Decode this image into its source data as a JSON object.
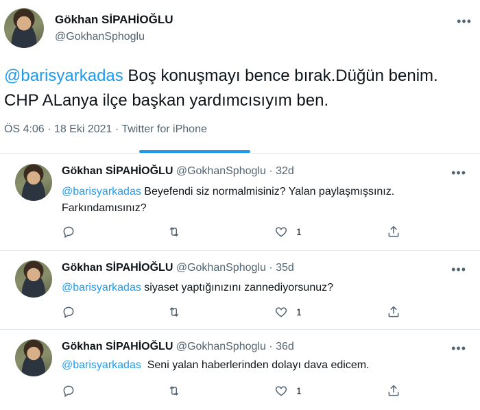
{
  "main_tweet": {
    "name": "Gökhan SİPAHİOĞLU",
    "handle": "@GokhanSphoglu",
    "mention": "@barisyarkadas",
    "text": " Boş konuşmayı bence bırak.Düğün benim. CHP ALanya ilçe başkan yardımcısıyım ben.",
    "meta": "ÖS 4:06 · 18 Eki 2021 · Twitter for iPhone"
  },
  "replies": [
    {
      "name": "Gökhan SİPAHİOĞLU",
      "handle": "@GokhanSphoglu",
      "separator": "·",
      "time": "32d",
      "mention": "@barisyarkadas",
      "text": " Beyefendi siz normalmisiniz? Yalan paylaşmışsınız. Farkındamısınız?",
      "like_count": "1"
    },
    {
      "name": "Gökhan SİPAHİOĞLU",
      "handle": "@GokhanSphoglu",
      "separator": "·",
      "time": "35d",
      "mention": "@barisyarkadas",
      "text": " siyaset yaptığınızını zannediyorsunuz?",
      "like_count": "1"
    },
    {
      "name": "Gökhan SİPAHİOĞLU",
      "handle": "@GokhanSphoglu",
      "separator": "·",
      "time": "36d",
      "mention": "@barisyarkadas",
      "text": "  Seni yalan haberlerinden dolayı dava edicem.",
      "like_count": "1"
    }
  ],
  "icons": {
    "more": "more-icon",
    "reply": "reply-icon",
    "retweet": "retweet-icon",
    "like": "heart-icon",
    "share": "share-icon"
  },
  "colors": {
    "accent": "#1d9bf0",
    "secondary_text": "#536471",
    "divider": "#e1e6ea"
  }
}
